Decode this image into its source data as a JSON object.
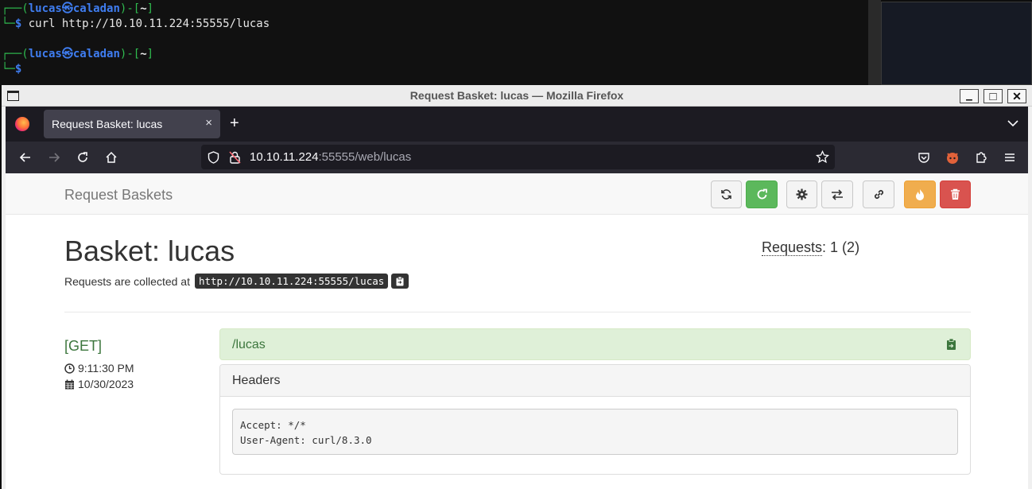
{
  "terminal": {
    "prompt_user": "lucas",
    "prompt_at": "㉿",
    "prompt_host": "caladan",
    "prompt_dir": "~",
    "command": "curl http://10.10.11.224:55555/lucas"
  },
  "window": {
    "title": "Request Basket: lucas — Mozilla Firefox",
    "min_label": "▁",
    "max_label": "□",
    "close_label": "✕"
  },
  "tabs": [
    {
      "label": "Request Basket: lucas",
      "close": "×"
    }
  ],
  "new_tab_label": "+",
  "url": {
    "host": "10.10.11.224",
    "rest": ":55555/web/lucas"
  },
  "app": {
    "brand": "Request Baskets",
    "basket_title": "Basket: lucas",
    "collected_prefix": "Requests are collected at",
    "collected_url": "http://10.10.11.224:55555/lucas",
    "requests_label": "Requests",
    "requests_value": ": 1 (2)"
  },
  "request": {
    "method": "[GET]",
    "time": "9:11:30 PM",
    "date": "10/30/2023",
    "path": "/lucas",
    "headers_title": "Headers",
    "headers": [
      "Accept: */*",
      "User-Agent: curl/8.3.0"
    ]
  },
  "colors": {
    "success": "#5cb85c",
    "warning": "#f0ad4e",
    "danger": "#d9534f",
    "success_text": "#3c763d",
    "success_bg": "#dff0d8"
  }
}
